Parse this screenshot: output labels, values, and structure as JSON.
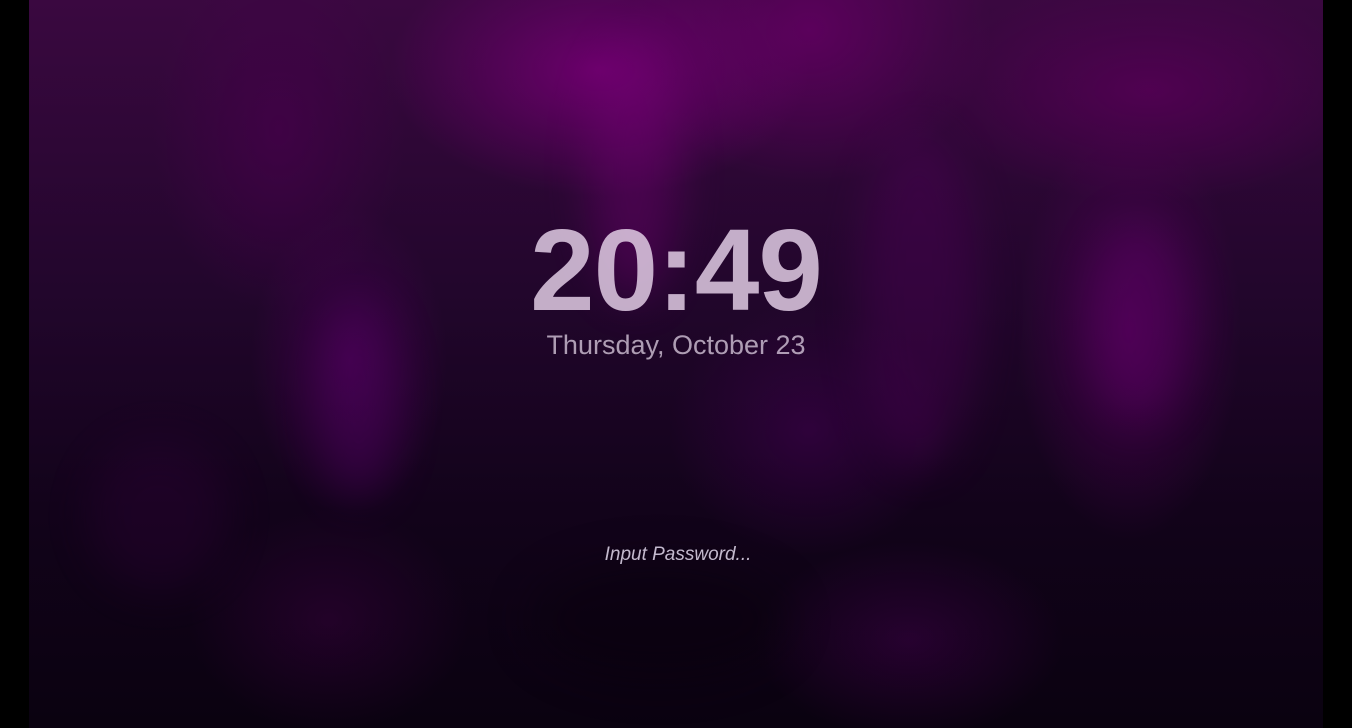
{
  "lockscreen": {
    "time": "20:49",
    "date": "Thursday, October 23",
    "password_placeholder": "Input Password..."
  },
  "colors": {
    "wallpaper_primary": "#6e006e",
    "wallpaper_dark": "#0a0210",
    "text": "#e1cde4"
  }
}
